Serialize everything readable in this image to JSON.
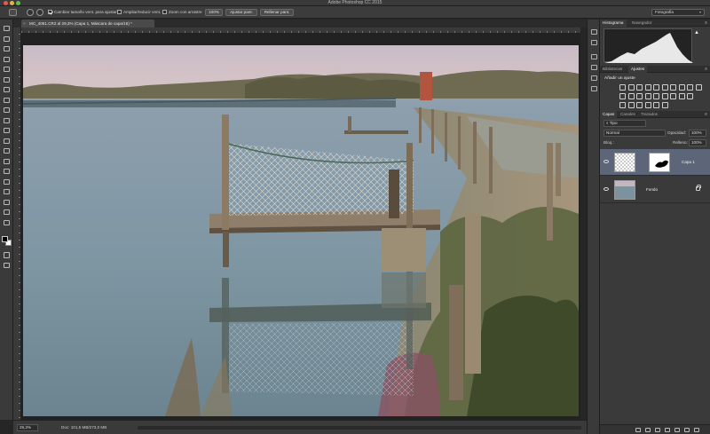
{
  "app": {
    "title": "Adobe Photoshop CC 2015",
    "traffic_colors": [
      "#e25a4d",
      "#e6b53c",
      "#5fbf4a"
    ]
  },
  "options_bar": {
    "resize_windows_label": "Cambiar tamaño vent. para ajustar",
    "resize_windows_checked": true,
    "zoom_all_windows_label": "Ampliar/reducir vent.",
    "zoom_all_windows_checked": false,
    "scrubby_zoom_label": "Zoom con arrastre",
    "scrubby_zoom_checked": false,
    "zoom_value": "100%",
    "fit_screen_label": "Ajustar pant.",
    "fill_screen_label": "Rellenar pant.",
    "workspace": "Fotografía"
  },
  "document": {
    "tab_title": "MC_4061.CR2 al 29,3% (Capa 1, Máscara de capa/16) *",
    "zoom_readout": "29,3%",
    "doc_info": "Doc: 101,5 MB/273,0 MB"
  },
  "toolbar": {
    "tools": [
      "move-tool",
      "marquee-tool",
      "lasso-tool",
      "quick-select-tool",
      "crop-tool",
      "eyedropper-tool",
      "healing-tool",
      "brush-tool",
      "stamp-tool",
      "history-brush-tool",
      "eraser-tool",
      "gradient-tool",
      "blur-tool",
      "dodge-tool",
      "pen-tool",
      "type-tool",
      "path-select-tool",
      "shape-tool",
      "hand-tool",
      "zoom-tool"
    ],
    "foreground_color": "#000000",
    "background_color": "#ffffff"
  },
  "panels": {
    "histogram_tabs": [
      "Histograma",
      "Navegador"
    ],
    "adjust_tabs": [
      "Bibliotecas",
      "Ajustes"
    ],
    "adjust_title": "Añadir un ajuste",
    "layers_tabs": [
      "Capas",
      "Canales",
      "Trazados"
    ],
    "filter_kind": "Tipo",
    "blend_mode": "Normal",
    "opacity_label": "Opacidad:",
    "opacity_value": "100%",
    "lock_label": "Bloq.:",
    "fill_label": "Relleno:",
    "fill_value": "100%",
    "layers": [
      {
        "name": "Capa 1",
        "selected": true,
        "visible": true
      },
      {
        "name": "Fondo",
        "selected": false,
        "visible": true,
        "locked": true
      }
    ]
  }
}
